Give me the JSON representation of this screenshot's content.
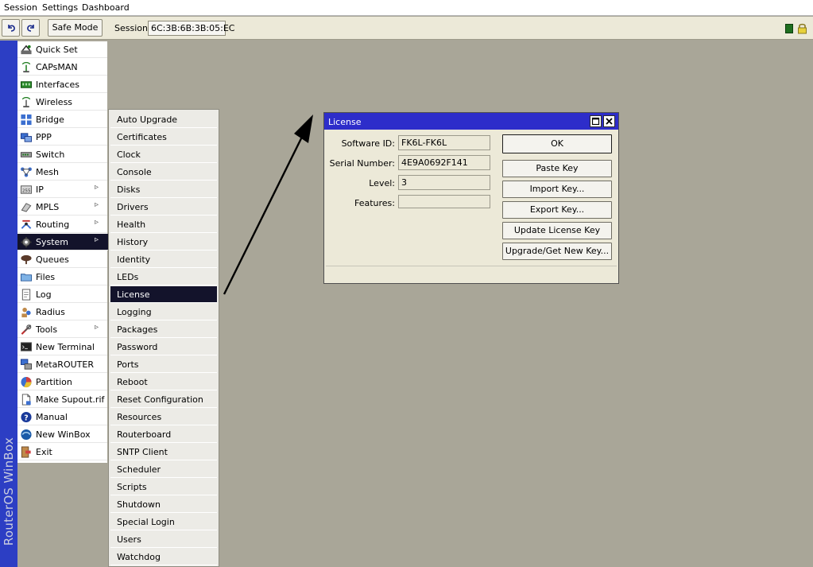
{
  "menubar": {
    "items": [
      "Session",
      "Settings",
      "Dashboard"
    ]
  },
  "toolbar": {
    "safe_mode": "Safe Mode",
    "session_label": "Session:",
    "session_value": "6C:3B:6B:3B:05:EC"
  },
  "sidebar": {
    "brand": "RouterOS WinBox",
    "items": [
      {
        "label": "Quick Set",
        "icon": "quick-set-icon",
        "submenu": false
      },
      {
        "label": "CAPsMAN",
        "icon": "capsman-icon",
        "submenu": false
      },
      {
        "label": "Interfaces",
        "icon": "interfaces-icon",
        "submenu": false
      },
      {
        "label": "Wireless",
        "icon": "wireless-icon",
        "submenu": false
      },
      {
        "label": "Bridge",
        "icon": "bridge-icon",
        "submenu": false
      },
      {
        "label": "PPP",
        "icon": "ppp-icon",
        "submenu": false
      },
      {
        "label": "Switch",
        "icon": "switch-icon",
        "submenu": false
      },
      {
        "label": "Mesh",
        "icon": "mesh-icon",
        "submenu": false
      },
      {
        "label": "IP",
        "icon": "ip-icon",
        "submenu": true
      },
      {
        "label": "MPLS",
        "icon": "mpls-icon",
        "submenu": true
      },
      {
        "label": "Routing",
        "icon": "routing-icon",
        "submenu": true
      },
      {
        "label": "System",
        "icon": "system-gear-icon",
        "submenu": true,
        "selected": true
      },
      {
        "label": "Queues",
        "icon": "queues-icon",
        "submenu": false
      },
      {
        "label": "Files",
        "icon": "folder-icon",
        "submenu": false
      },
      {
        "label": "Log",
        "icon": "log-icon",
        "submenu": false
      },
      {
        "label": "Radius",
        "icon": "radius-icon",
        "submenu": false
      },
      {
        "label": "Tools",
        "icon": "tools-icon",
        "submenu": true
      },
      {
        "label": "New Terminal",
        "icon": "terminal-icon",
        "submenu": false
      },
      {
        "label": "MetaROUTER",
        "icon": "metarouter-icon",
        "submenu": false
      },
      {
        "label": "Partition",
        "icon": "partition-icon",
        "submenu": false
      },
      {
        "label": "Make Supout.rif",
        "icon": "supout-file-icon",
        "submenu": false
      },
      {
        "label": "Manual",
        "icon": "help-icon",
        "submenu": false
      },
      {
        "label": "New WinBox",
        "icon": "winbox-icon",
        "submenu": false
      },
      {
        "label": "Exit",
        "icon": "exit-icon",
        "submenu": false
      }
    ]
  },
  "submenu": {
    "items": [
      "Auto Upgrade",
      "Certificates",
      "Clock",
      "Console",
      "Disks",
      "Drivers",
      "Health",
      "History",
      "Identity",
      "LEDs",
      "License",
      "Logging",
      "Packages",
      "Password",
      "Ports",
      "Reboot",
      "Reset Configuration",
      "Resources",
      "Routerboard",
      "SNTP Client",
      "Scheduler",
      "Scripts",
      "Shutdown",
      "Special Login",
      "Users",
      "Watchdog"
    ],
    "selected": "License"
  },
  "license_window": {
    "title": "License",
    "fields": {
      "software_id_label": "Software ID:",
      "software_id": "FK6L-FK6L",
      "serial_label": "Serial Number:",
      "serial": "4E9A0692F141",
      "level_label": "Level:",
      "level": "3",
      "features_label": "Features:",
      "features": ""
    },
    "buttons": {
      "ok": "OK",
      "paste_key": "Paste Key",
      "import_key": "Import Key...",
      "export_key": "Export Key...",
      "update_license_key": "Update License Key",
      "upgrade_get_new_key": "Upgrade/Get New Key..."
    }
  },
  "colors": {
    "desktop": "#a9a698",
    "sidebar_strip": "#2c3ec4",
    "selection": "#13132b",
    "window_title": "#2d2dca"
  }
}
